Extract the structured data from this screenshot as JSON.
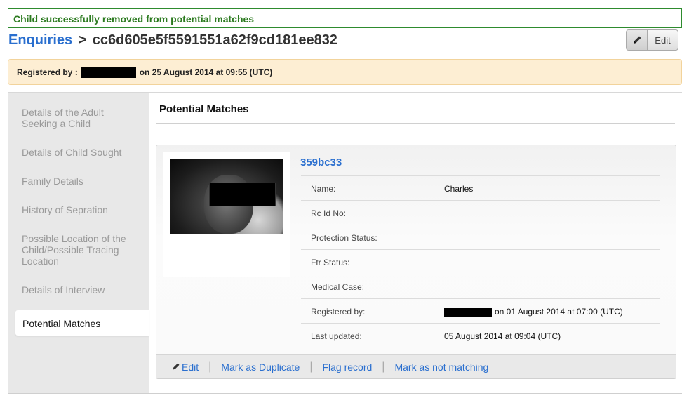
{
  "flash": {
    "message": "Child successfully removed from potential matches"
  },
  "header": {
    "breadcrumb_link": "Enquiries",
    "breadcrumb_separator": ">",
    "record_id": "cc6d605e5f5591551a62f9cd181ee832",
    "edit_label": "Edit",
    "edit_icon": "pencil-icon"
  },
  "registered": {
    "prefix": "Registered by :",
    "suffix": "on 25 August 2014 at 09:55 (UTC)"
  },
  "sidebar": {
    "items": [
      {
        "label": "Details of the Adult Seeking a Child"
      },
      {
        "label": "Details of Child Sought"
      },
      {
        "label": "Family Details"
      },
      {
        "label": "History of Sepration"
      },
      {
        "label": "Possible Location of the Child/Possible Tracing Location"
      },
      {
        "label": "Details of Interview"
      }
    ],
    "active": "Potential Matches"
  },
  "main": {
    "heading": "Potential Matches",
    "match": {
      "id": "359bc33",
      "fields": [
        {
          "label": "Name:",
          "value": "Charles"
        },
        {
          "label": "Rc Id No:",
          "value": ""
        },
        {
          "label": "Protection Status:",
          "value": ""
        },
        {
          "label": "Ftr Status:",
          "value": ""
        },
        {
          "label": "Medical Case:",
          "value": ""
        },
        {
          "label": "Registered by:",
          "value": "on 01 August 2014 at 07:00 (UTC)"
        },
        {
          "label": "Last updated:",
          "value": "05 August 2014 at 09:04 (UTC)"
        }
      ],
      "actions": {
        "edit": "Edit",
        "mark_duplicate": "Mark as Duplicate",
        "flag": "Flag record",
        "not_matching": "Mark as not matching"
      }
    }
  },
  "colors": {
    "link": "#2a6fcf",
    "flash_text": "#2b7a1f",
    "registered_bg": "#fdeed3",
    "sidebar_bg": "#e8e8e8"
  }
}
